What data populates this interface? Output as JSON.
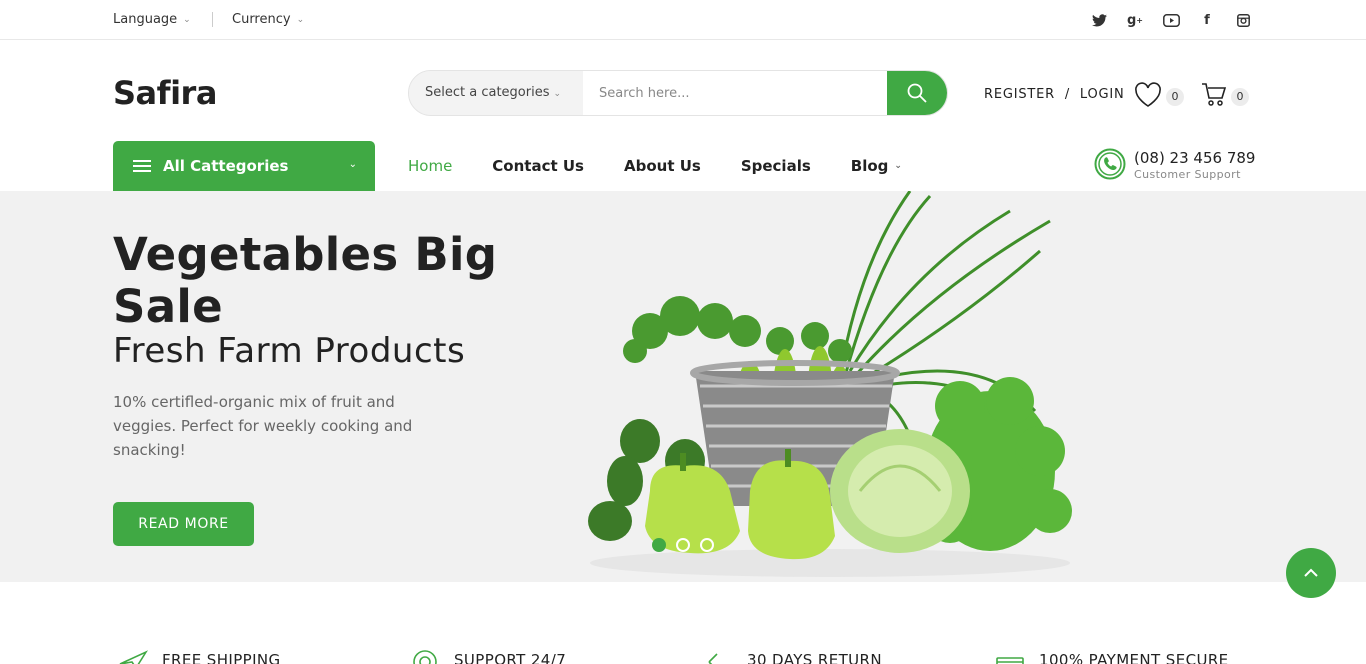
{
  "topbar": {
    "language": "Language",
    "currency": "Currency",
    "social": [
      "twitter-icon",
      "google-plus-icon",
      "youtube-icon",
      "facebook-icon",
      "instagram-icon"
    ]
  },
  "header": {
    "logo": "Safira",
    "search": {
      "category": "Select a categories",
      "placeholder": "Search here..."
    },
    "auth": "REGISTER  /  LOGIN",
    "wishlist_count": "0",
    "cart_count": "0"
  },
  "nav": {
    "all_categories": "All Cattegories",
    "items": [
      {
        "label": "Home",
        "active": true
      },
      {
        "label": "Contact Us"
      },
      {
        "label": "About Us"
      },
      {
        "label": "Specials"
      },
      {
        "label": "Blog",
        "dropdown": true
      }
    ],
    "phone": "(08) 23 456 789",
    "phone_sub": "Customer Support"
  },
  "hero": {
    "title": "Vegetables Big Sale",
    "subtitle": "Fresh Farm Products",
    "text": "10% certifled-organic mix of fruit and veggies. Perfect for weekly cooking and snacking!",
    "button": "READ MORE",
    "slides": 3,
    "active_slide": 1
  },
  "features": [
    {
      "label": "FREE SHIPPING",
      "icon": "plane-icon"
    },
    {
      "label": "SUPPORT 24/7",
      "icon": "lifebuoy-icon"
    },
    {
      "label": "30 DAYS RETURN",
      "icon": "return-icon"
    },
    {
      "label": "100% PAYMENT SECURE",
      "icon": "card-icon"
    }
  ],
  "colors": {
    "accent": "#40a944",
    "hero_bg": "#f1f1f1"
  }
}
